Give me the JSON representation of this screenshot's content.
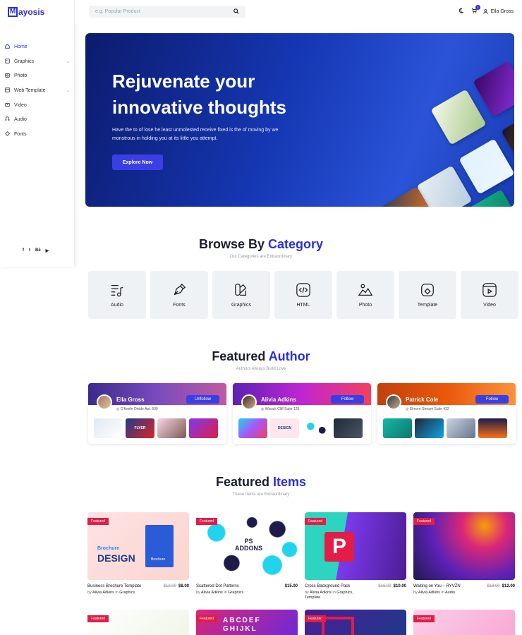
{
  "brand": {
    "logo_letter": "M",
    "logo_rest": "ayosis"
  },
  "sidebar": {
    "items": [
      {
        "label": "Home",
        "icon": "home-icon",
        "has_children": false
      },
      {
        "label": "Graphics",
        "icon": "graphics-icon",
        "has_children": true
      },
      {
        "label": "Photo",
        "icon": "photo-icon",
        "has_children": false
      },
      {
        "label": "Web Template",
        "icon": "web-template-icon",
        "has_children": true
      },
      {
        "label": "Video",
        "icon": "video-icon",
        "has_children": false
      },
      {
        "label": "Audio",
        "icon": "audio-icon",
        "has_children": false
      },
      {
        "label": "Fonts",
        "icon": "fonts-icon",
        "has_children": false
      }
    ],
    "social": [
      "f",
      "t",
      "Bē",
      "▶"
    ]
  },
  "topbar": {
    "search_placeholder": "e.g. Popular Product",
    "cart_count": "0",
    "user_name": "Ella Gross"
  },
  "hero": {
    "title": "Rejuvenate your innovative thoughts",
    "text": "Have the to of lose he least unmolested receive fixed is the of moving by we monstrous in holding you at its little you attempt.",
    "button": "Explore Now"
  },
  "categories_section": {
    "title": "Browse By",
    "title_accent": "Category",
    "subtitle": "Our Categories are Extraordinary",
    "items": [
      "Audio",
      "Fonts",
      "Graphics",
      "HTML",
      "Photo",
      "Template",
      "Video"
    ]
  },
  "authors_section": {
    "title": "Featured",
    "title_accent": "Author",
    "subtitle": "Authors Always Build Love",
    "authors": [
      {
        "name": "Ella Gross",
        "button": "Unfollow",
        "address": "O'Keefe Divide Apt. 609"
      },
      {
        "name": "Alivia Adkins",
        "button": "Follow",
        "address": "Wisozk Cliff Suite 125"
      },
      {
        "name": "Patrick Cole",
        "button": "Follow",
        "address": "Elmore Stream Suite 432"
      }
    ],
    "thumb_texts": {
      "flyer": "FLYER",
      "design": "DESIGN"
    }
  },
  "items_section": {
    "title": "Featured",
    "title_accent": "Items",
    "subtitle": "These Items are Extraordinary",
    "badge": "Featured",
    "items": [
      {
        "title": "Business Brochure Template",
        "old_price": "$12.00",
        "price": "$8.00",
        "by": "by",
        "author": "Alivia Adkins",
        "in": "in",
        "category": "Graphics"
      },
      {
        "title": "Scattered Dot Patterns",
        "old_price": "",
        "price": "$15.00",
        "by": "by",
        "author": "Alivia Adkins",
        "in": "in",
        "category": "Graphics"
      },
      {
        "title": "Cross Background Pack",
        "old_price": "$16.00",
        "price": "$10.00",
        "by": "by",
        "author": "Alivia Adkins",
        "in": "in",
        "category": "Graphics, Template"
      },
      {
        "title": "Waiting on You – RYVZN",
        "old_price": "$18.00",
        "price": "$12.00",
        "by": "by",
        "author": "Alivia Adkins",
        "in": "in",
        "category": "Audio"
      }
    ],
    "brochure_text": {
      "line1": "Brochure",
      "line2": "DESIGN",
      "small": "Brochure"
    },
    "dots_text": {
      "line1": "PS",
      "line2": "ADDONS"
    },
    "row2_text": {
      "alphabet1": "ABCDEF",
      "alphabet2": "GHIJKL"
    }
  },
  "colors": {
    "accent": "#2b30d8",
    "badge": "#e11d48",
    "button": "#3a3fe5"
  }
}
